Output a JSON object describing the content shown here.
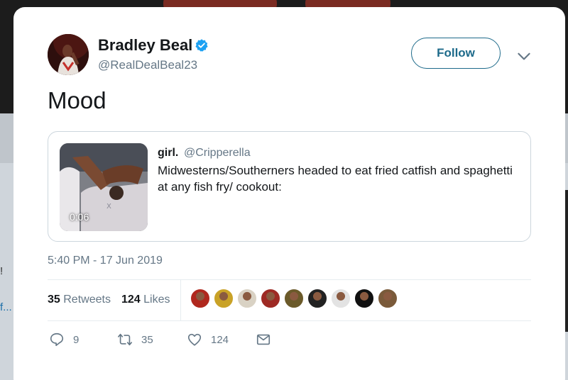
{
  "tweet": {
    "display_name": "Bradley Beal",
    "handle": "@RealDealBeal23",
    "follow_label": "Follow",
    "text": "Mood",
    "timestamp": "5:40 PM - 17 Jun 2019"
  },
  "quoted_tweet": {
    "name": "girl.",
    "handle": "@Cripperella",
    "text": "Midwesterns/Southerners headed to eat fried catfish and spaghetti at any fish fry/ cookout:",
    "video_duration": "0:06"
  },
  "stats": {
    "retweets_count": "35",
    "retweets_label": "Retweets",
    "likes_count": "124",
    "likes_label": "Likes",
    "liker_avatar_colors": [
      "#b0281e",
      "#c9a227",
      "#d9d2c4",
      "#9e2a24",
      "#6b5a2a",
      "#222222",
      "#e3e3e3",
      "#111111",
      "#7a5a3a"
    ]
  },
  "actions": {
    "reply_count": "9",
    "retweet_count": "35",
    "like_count": "124"
  },
  "background": {
    "ghost_lines": [
      "!",
      "f..."
    ]
  },
  "colors": {
    "accent": "#1d6a8a",
    "verified": "#1da1f2",
    "secondary_text": "#657786",
    "primary_text": "#14171a"
  }
}
